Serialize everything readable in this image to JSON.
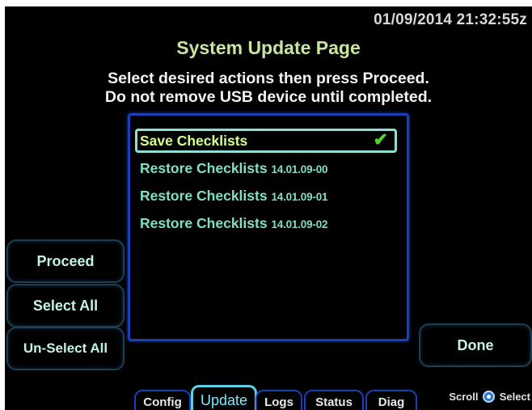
{
  "header": {
    "timestamp": "01/09/2014 21:32:55z",
    "title": "System Update Page",
    "instruction_line1": "Select desired actions then press Proceed.",
    "instruction_line2": "Do not remove USB device until completed."
  },
  "action_list": {
    "items": [
      {
        "label": "Save Checklists",
        "version": "",
        "selected": true,
        "checked": true
      },
      {
        "label": "Restore Checklists",
        "version": "14.01.09-00",
        "selected": false,
        "checked": false
      },
      {
        "label": "Restore Checklists",
        "version": "14.01.09-01",
        "selected": false,
        "checked": false
      },
      {
        "label": "Restore Checklists",
        "version": "14.01.09-02",
        "selected": false,
        "checked": false
      }
    ],
    "check_glyph": "✔"
  },
  "buttons": {
    "proceed": "Proceed",
    "select_all": "Select All",
    "unselect_all": "Un-Select All",
    "done": "Done"
  },
  "tabs": [
    {
      "label": "Config",
      "active": false
    },
    {
      "label": "Update",
      "active": true
    },
    {
      "label": "Logs",
      "active": false
    },
    {
      "label": "Status",
      "active": false
    },
    {
      "label": "Diag",
      "active": false
    }
  ],
  "footer": {
    "scroll_label": "Scroll",
    "select_label": "Select",
    "knob_icon": "rotary-knob-icon"
  },
  "colors": {
    "background": "#000000",
    "title": "#c8e6a0",
    "list_text": "#7ee0c8",
    "selected_text": "#d8ff8a",
    "check": "#5cd02a",
    "list_border": "#1b3fb8",
    "active_tab": "#5fd0e8"
  }
}
